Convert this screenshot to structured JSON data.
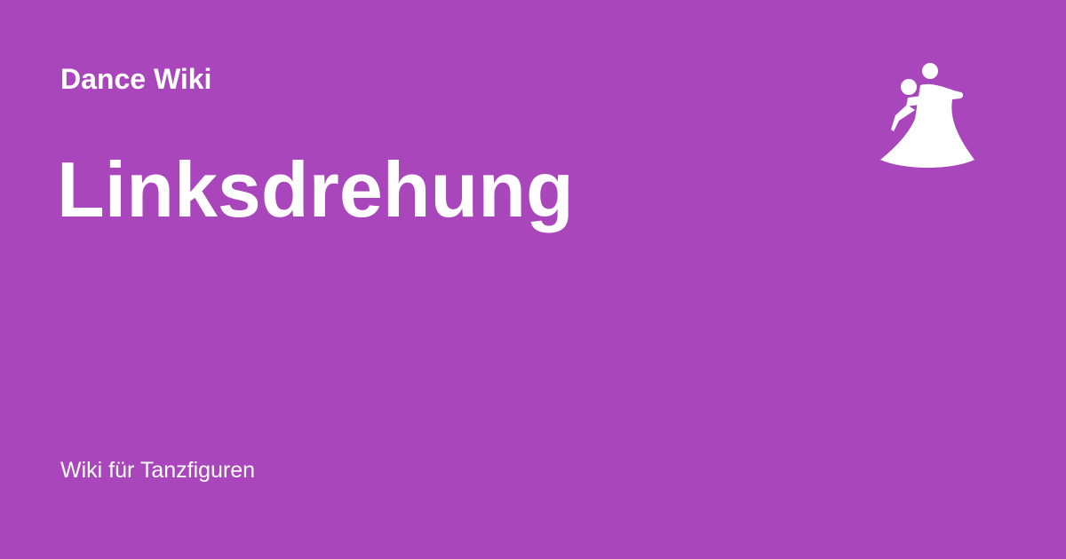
{
  "header": {
    "site_name": "Dance Wiki",
    "logo_icon": "ballroom-dancers-icon"
  },
  "main": {
    "title": "Linksdrehung"
  },
  "footer": {
    "tagline": "Wiki für Tanzfiguren"
  },
  "colors": {
    "background": "#a946bb",
    "text": "#ffffff"
  }
}
